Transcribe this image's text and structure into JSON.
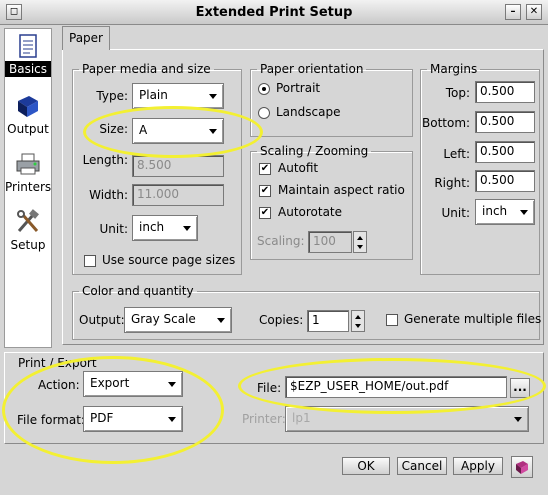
{
  "window": {
    "title": "Extended Print Setup"
  },
  "sidebar": {
    "items": [
      {
        "label": "Basics",
        "icon": "document-icon",
        "selected": true
      },
      {
        "label": "Output",
        "icon": "book-icon"
      },
      {
        "label": "Printers",
        "icon": "printer-icon"
      },
      {
        "label": "Setup",
        "icon": "tools-icon"
      }
    ]
  },
  "tabs": {
    "paper": "Paper"
  },
  "paper_media": {
    "legend": "Paper media and size",
    "type_label": "Type:",
    "type_value": "Plain",
    "size_label": "Size:",
    "size_value": "A",
    "length_label": "Length:",
    "length_value": "8.500",
    "width_label": "Width:",
    "width_value": "11.000",
    "unit_label": "Unit:",
    "unit_value": "inch",
    "use_source_label": "Use source page sizes"
  },
  "orientation": {
    "legend": "Paper orientation",
    "portrait": "Portrait",
    "landscape": "Landscape"
  },
  "scaling": {
    "legend": "Scaling / Zooming",
    "autofit": "Autofit",
    "maintain": "Maintain aspect ratio",
    "autorotate": "Autorotate",
    "scaling_label": "Scaling:",
    "scaling_value": "100"
  },
  "margins": {
    "legend": "Margins",
    "top_label": "Top:",
    "top_value": "0.500",
    "bottom_label": "Bottom:",
    "bottom_value": "0.500",
    "left_label": "Left:",
    "left_value": "0.500",
    "right_label": "Right:",
    "right_value": "0.500",
    "unit_label": "Unit:",
    "unit_value": "inch"
  },
  "color": {
    "legend": "Color and quantity",
    "output_label": "Output:",
    "output_value": "Gray Scale",
    "copies_label": "Copies:",
    "copies_value": "1",
    "multiple_label": "Generate multiple files"
  },
  "print_export": {
    "legend": "Print / Export",
    "action_label": "Action:",
    "action_value": "Export",
    "format_label": "File format:",
    "format_value": "PDF",
    "file_label": "File:",
    "file_value": "$EZP_USER_HOME/out.pdf",
    "browse_label": "...",
    "printer_label": "Printer:",
    "printer_value": "lp1"
  },
  "buttons": {
    "ok": "OK",
    "cancel": "Cancel",
    "apply": "Apply"
  },
  "colors": {
    "highlight": "#f3f032"
  }
}
